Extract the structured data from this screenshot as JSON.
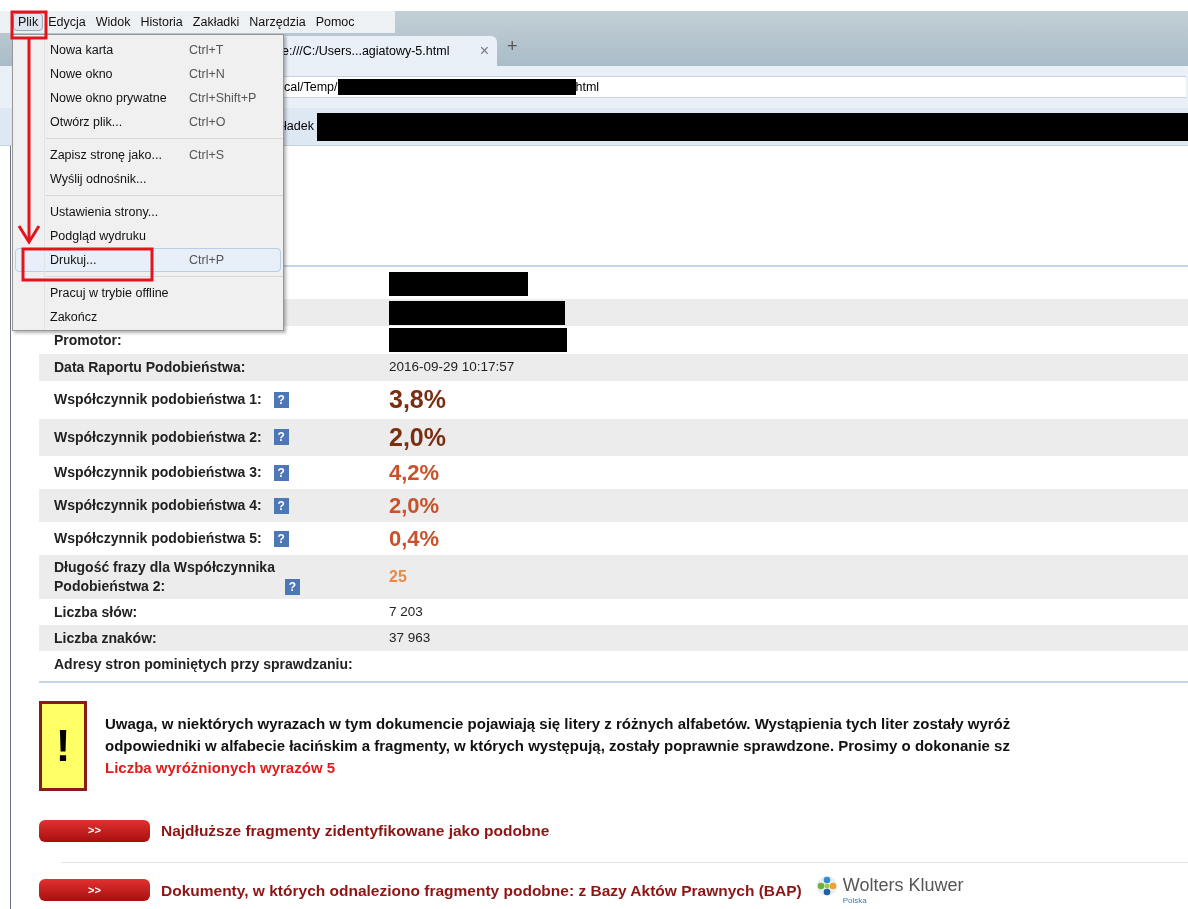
{
  "menubar": [
    {
      "label": "Plik",
      "selected": true
    },
    {
      "label": "Edycja",
      "selected": false
    },
    {
      "label": "Widok",
      "selected": false
    },
    {
      "label": "Historia",
      "selected": false
    },
    {
      "label": "Zakładki",
      "selected": false
    },
    {
      "label": "Narzędzia",
      "selected": false
    },
    {
      "label": "Pomoc",
      "selected": false
    }
  ],
  "tab": {
    "title": "e:///C:/Users...agiatowy-5.html",
    "close": "×",
    "new_tab": "+"
  },
  "address": {
    "before": "cal/Temp/",
    "after": "html"
  },
  "bookmark": {
    "label": "ładek"
  },
  "file_menu": {
    "groups": [
      [
        {
          "label": "Nowa karta",
          "shortcut": "Ctrl+T",
          "highlighted": false
        },
        {
          "label": "Nowe okno",
          "shortcut": "Ctrl+N",
          "highlighted": false
        },
        {
          "label": "Nowe okno prywatne",
          "shortcut": "Ctrl+Shift+P",
          "highlighted": false
        },
        {
          "label": "Otwórz plik...",
          "shortcut": "Ctrl+O",
          "highlighted": false
        }
      ],
      [
        {
          "label": "Zapisz stronę jako...",
          "shortcut": "Ctrl+S",
          "highlighted": false
        },
        {
          "label": "Wyślij odnośnik...",
          "highlighted": false
        }
      ],
      [
        {
          "label": "Ustawienia strony...",
          "highlighted": false
        },
        {
          "label": "Podgląd wydruku",
          "highlighted": false
        },
        {
          "label": "Drukuj...",
          "shortcut": "Ctrl+P",
          "highlighted": true
        }
      ],
      [
        {
          "label": "Pracuj w trybie offline",
          "highlighted": false
        },
        {
          "label": "Zakończ",
          "highlighted": false
        }
      ]
    ]
  },
  "report_rows": [
    {
      "kind": "plain",
      "redacted": true
    },
    {
      "kind": "plain",
      "redacted": true
    },
    {
      "kind": "plain",
      "label": "Promotor:",
      "redacted": true
    },
    {
      "kind": "plain",
      "label": "Data Raportu Podobieństwa:",
      "value": "2016-09-29 10:17:57"
    },
    {
      "kind": "major",
      "label": "Współczynnik podobieństwa 1:",
      "help": "?",
      "value": "3,8%"
    },
    {
      "kind": "major",
      "label": "Współczynnik podobieństwa 2:",
      "help": "?",
      "value": "2,0%"
    },
    {
      "kind": "minor",
      "label": "Współczynnik podobieństwa 3:",
      "help": "?",
      "value": "4,2%"
    },
    {
      "kind": "minor",
      "label": "Współczynnik podobieństwa 4:",
      "help": "?",
      "value": "2,0%"
    },
    {
      "kind": "minor",
      "label": "Współczynnik podobieństwa 5:",
      "help": "?",
      "value": "0,4%"
    },
    {
      "kind": "phrase",
      "label": "Długość frazy dla Współczynnika Podobieństwa 2:",
      "help": "?",
      "value": "25"
    },
    {
      "kind": "plain",
      "label": "Liczba słów:",
      "value": "7 203"
    },
    {
      "kind": "plain",
      "label": "Liczba znaków:",
      "value": "37 963"
    },
    {
      "kind": "plain",
      "label": "Adresy stron pominiętych przy sprawdzaniu:"
    }
  ],
  "warning": {
    "icon": "!",
    "lines": [
      "Uwaga, w niektórych wyrazach w tym dokumencie pojawiają się litery z różnych alfabetów. Wystąpienia tych liter zostały wyróż",
      "odpowiedniki w alfabecie łacińskim a fragmenty, w których występują, zostały poprawnie sprawdzone. Prosimy o dokonanie sz"
    ],
    "count": "Liczba wyróżnionych wyrazów 5"
  },
  "sections": [
    {
      "button": ">>",
      "title": "Najdłuższe fragmenty zidentyfikowane jako podobne"
    },
    {
      "button": ">>",
      "title": "Dokumenty, w których odnaleziono fragmenty podobne: z Bazy Aktów Prawnych (BAP)",
      "logo": {
        "name": "Wolters Kluwer",
        "subtitle": "Polska"
      }
    }
  ]
}
